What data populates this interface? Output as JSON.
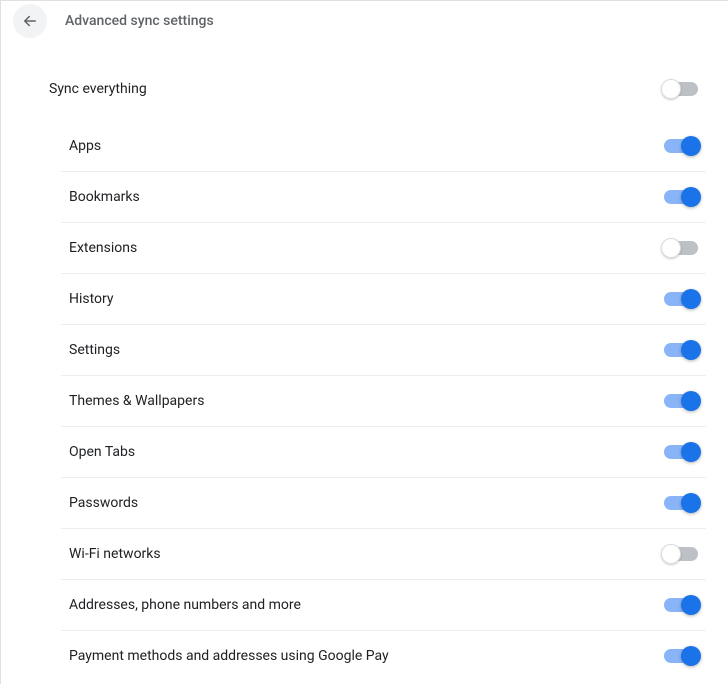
{
  "header": {
    "title": "Advanced sync settings"
  },
  "master": {
    "label": "Sync everything",
    "enabled": false
  },
  "items": [
    {
      "id": "apps",
      "label": "Apps",
      "enabled": true
    },
    {
      "id": "bookmarks",
      "label": "Bookmarks",
      "enabled": true
    },
    {
      "id": "extensions",
      "label": "Extensions",
      "enabled": false
    },
    {
      "id": "history",
      "label": "History",
      "enabled": true
    },
    {
      "id": "settings",
      "label": "Settings",
      "enabled": true
    },
    {
      "id": "themes",
      "label": "Themes & Wallpapers",
      "enabled": true
    },
    {
      "id": "open-tabs",
      "label": "Open Tabs",
      "enabled": true
    },
    {
      "id": "passwords",
      "label": "Passwords",
      "enabled": true
    },
    {
      "id": "wifi",
      "label": "Wi-Fi networks",
      "enabled": false
    },
    {
      "id": "addresses",
      "label": "Addresses, phone numbers and more",
      "enabled": true
    },
    {
      "id": "payment",
      "label": "Payment methods and addresses using Google Pay",
      "enabled": true
    }
  ]
}
